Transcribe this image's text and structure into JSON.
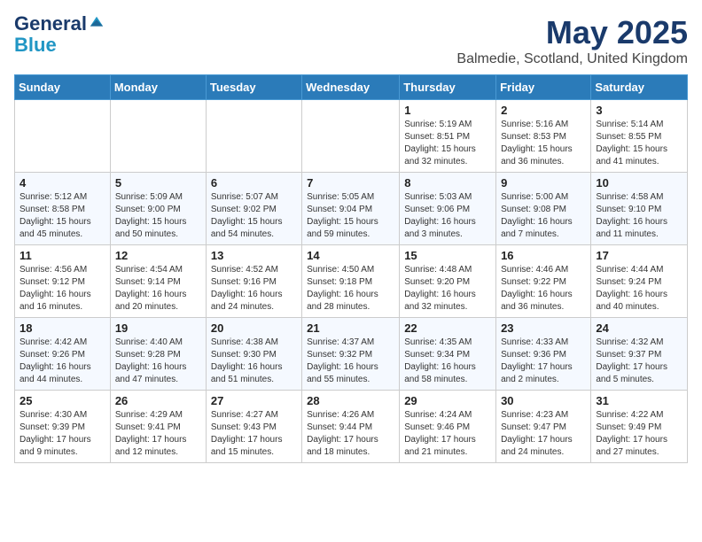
{
  "header": {
    "logo_general": "General",
    "logo_blue": "Blue",
    "month_title": "May 2025",
    "location": "Balmedie, Scotland, United Kingdom"
  },
  "days_of_week": [
    "Sunday",
    "Monday",
    "Tuesday",
    "Wednesday",
    "Thursday",
    "Friday",
    "Saturday"
  ],
  "weeks": [
    [
      {
        "day": "",
        "info": ""
      },
      {
        "day": "",
        "info": ""
      },
      {
        "day": "",
        "info": ""
      },
      {
        "day": "",
        "info": ""
      },
      {
        "day": "1",
        "info": "Sunrise: 5:19 AM\nSunset: 8:51 PM\nDaylight: 15 hours\nand 32 minutes."
      },
      {
        "day": "2",
        "info": "Sunrise: 5:16 AM\nSunset: 8:53 PM\nDaylight: 15 hours\nand 36 minutes."
      },
      {
        "day": "3",
        "info": "Sunrise: 5:14 AM\nSunset: 8:55 PM\nDaylight: 15 hours\nand 41 minutes."
      }
    ],
    [
      {
        "day": "4",
        "info": "Sunrise: 5:12 AM\nSunset: 8:58 PM\nDaylight: 15 hours\nand 45 minutes."
      },
      {
        "day": "5",
        "info": "Sunrise: 5:09 AM\nSunset: 9:00 PM\nDaylight: 15 hours\nand 50 minutes."
      },
      {
        "day": "6",
        "info": "Sunrise: 5:07 AM\nSunset: 9:02 PM\nDaylight: 15 hours\nand 54 minutes."
      },
      {
        "day": "7",
        "info": "Sunrise: 5:05 AM\nSunset: 9:04 PM\nDaylight: 15 hours\nand 59 minutes."
      },
      {
        "day": "8",
        "info": "Sunrise: 5:03 AM\nSunset: 9:06 PM\nDaylight: 16 hours\nand 3 minutes."
      },
      {
        "day": "9",
        "info": "Sunrise: 5:00 AM\nSunset: 9:08 PM\nDaylight: 16 hours\nand 7 minutes."
      },
      {
        "day": "10",
        "info": "Sunrise: 4:58 AM\nSunset: 9:10 PM\nDaylight: 16 hours\nand 11 minutes."
      }
    ],
    [
      {
        "day": "11",
        "info": "Sunrise: 4:56 AM\nSunset: 9:12 PM\nDaylight: 16 hours\nand 16 minutes."
      },
      {
        "day": "12",
        "info": "Sunrise: 4:54 AM\nSunset: 9:14 PM\nDaylight: 16 hours\nand 20 minutes."
      },
      {
        "day": "13",
        "info": "Sunrise: 4:52 AM\nSunset: 9:16 PM\nDaylight: 16 hours\nand 24 minutes."
      },
      {
        "day": "14",
        "info": "Sunrise: 4:50 AM\nSunset: 9:18 PM\nDaylight: 16 hours\nand 28 minutes."
      },
      {
        "day": "15",
        "info": "Sunrise: 4:48 AM\nSunset: 9:20 PM\nDaylight: 16 hours\nand 32 minutes."
      },
      {
        "day": "16",
        "info": "Sunrise: 4:46 AM\nSunset: 9:22 PM\nDaylight: 16 hours\nand 36 minutes."
      },
      {
        "day": "17",
        "info": "Sunrise: 4:44 AM\nSunset: 9:24 PM\nDaylight: 16 hours\nand 40 minutes."
      }
    ],
    [
      {
        "day": "18",
        "info": "Sunrise: 4:42 AM\nSunset: 9:26 PM\nDaylight: 16 hours\nand 44 minutes."
      },
      {
        "day": "19",
        "info": "Sunrise: 4:40 AM\nSunset: 9:28 PM\nDaylight: 16 hours\nand 47 minutes."
      },
      {
        "day": "20",
        "info": "Sunrise: 4:38 AM\nSunset: 9:30 PM\nDaylight: 16 hours\nand 51 minutes."
      },
      {
        "day": "21",
        "info": "Sunrise: 4:37 AM\nSunset: 9:32 PM\nDaylight: 16 hours\nand 55 minutes."
      },
      {
        "day": "22",
        "info": "Sunrise: 4:35 AM\nSunset: 9:34 PM\nDaylight: 16 hours\nand 58 minutes."
      },
      {
        "day": "23",
        "info": "Sunrise: 4:33 AM\nSunset: 9:36 PM\nDaylight: 17 hours\nand 2 minutes."
      },
      {
        "day": "24",
        "info": "Sunrise: 4:32 AM\nSunset: 9:37 PM\nDaylight: 17 hours\nand 5 minutes."
      }
    ],
    [
      {
        "day": "25",
        "info": "Sunrise: 4:30 AM\nSunset: 9:39 PM\nDaylight: 17 hours\nand 9 minutes."
      },
      {
        "day": "26",
        "info": "Sunrise: 4:29 AM\nSunset: 9:41 PM\nDaylight: 17 hours\nand 12 minutes."
      },
      {
        "day": "27",
        "info": "Sunrise: 4:27 AM\nSunset: 9:43 PM\nDaylight: 17 hours\nand 15 minutes."
      },
      {
        "day": "28",
        "info": "Sunrise: 4:26 AM\nSunset: 9:44 PM\nDaylight: 17 hours\nand 18 minutes."
      },
      {
        "day": "29",
        "info": "Sunrise: 4:24 AM\nSunset: 9:46 PM\nDaylight: 17 hours\nand 21 minutes."
      },
      {
        "day": "30",
        "info": "Sunrise: 4:23 AM\nSunset: 9:47 PM\nDaylight: 17 hours\nand 24 minutes."
      },
      {
        "day": "31",
        "info": "Sunrise: 4:22 AM\nSunset: 9:49 PM\nDaylight: 17 hours\nand 27 minutes."
      }
    ]
  ]
}
